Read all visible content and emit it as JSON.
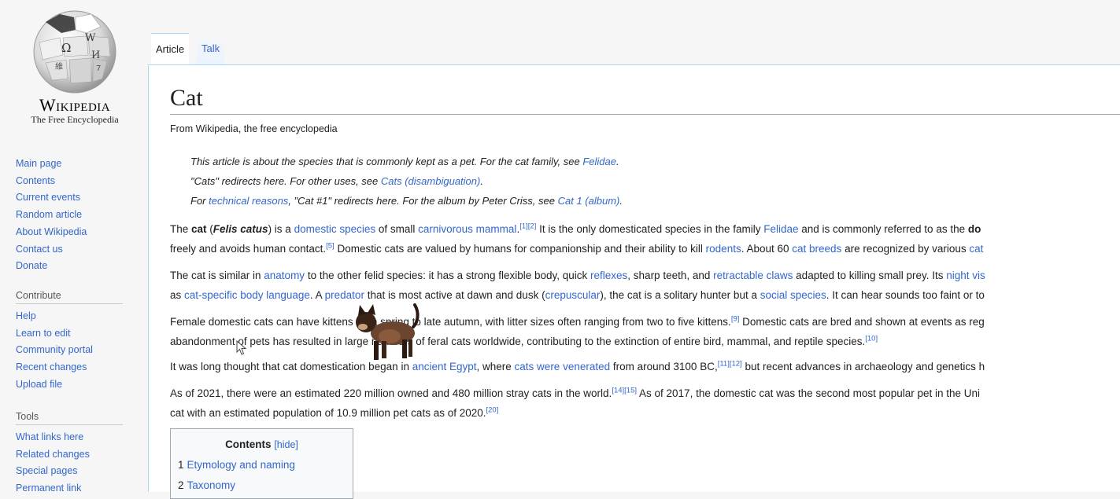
{
  "sidebar": {
    "wordmark": "Wikipedia",
    "tagline": "The Free Encyclopedia",
    "main_links": [
      "Main page",
      "Contents",
      "Current events",
      "Random article",
      "About Wikipedia",
      "Contact us",
      "Donate"
    ],
    "contribute": {
      "heading": "Contribute",
      "links": [
        "Help",
        "Learn to edit",
        "Community portal",
        "Recent changes",
        "Upload file"
      ]
    },
    "tools": {
      "heading": "Tools",
      "links": [
        "What links here",
        "Related changes",
        "Special pages",
        "Permanent link"
      ]
    }
  },
  "tabs": {
    "article": "Article",
    "talk": "Talk"
  },
  "article": {
    "title": "Cat",
    "site_sub": "From Wikipedia, the free encyclopedia",
    "hatnotes": [
      [
        {
          "t": "This article is about the species that is commonly kept as a pet. For the cat family, see "
        },
        {
          "t": "Felidae",
          "l": 1
        },
        {
          "t": "."
        }
      ],
      [
        {
          "t": "\"Cats\" redirects here. For other uses, see "
        },
        {
          "t": "Cats (disambiguation)",
          "l": 1
        },
        {
          "t": "."
        }
      ],
      [
        {
          "t": "For "
        },
        {
          "t": "technical reasons",
          "l": 1
        },
        {
          "t": ", \"Cat #1\" redirects here. For the album by Peter Criss, see "
        },
        {
          "t": "Cat 1 (album)",
          "l": 1
        },
        {
          "t": "."
        }
      ]
    ],
    "paragraphs": [
      [
        [
          {
            "t": "The "
          },
          {
            "t": "cat",
            "b": 1
          },
          {
            "t": " ("
          },
          {
            "t": "Felis catus",
            "b": 1,
            "i": 1
          },
          {
            "t": ") is a "
          },
          {
            "t": "domestic species",
            "l": 1
          },
          {
            "t": " of small "
          },
          {
            "t": "carnivorous mammal",
            "l": 1
          },
          {
            "t": "."
          },
          {
            "t": "[1][2]",
            "s": 1
          },
          {
            "t": " It is the only domesticated species in the family "
          },
          {
            "t": "Felidae",
            "l": 1
          },
          {
            "t": " and is commonly referred to as the "
          },
          {
            "t": "do",
            "b": 1
          }
        ],
        [
          {
            "t": "freely and avoids human contact."
          },
          {
            "t": "[5]",
            "s": 1
          },
          {
            "t": " Domestic cats are valued by humans for companionship and their ability to kill "
          },
          {
            "t": "rodents",
            "l": 1
          },
          {
            "t": ". About 60 "
          },
          {
            "t": "cat breeds",
            "l": 1
          },
          {
            "t": " are recognized by various "
          },
          {
            "t": "cat",
            "l": 1
          }
        ]
      ],
      [
        [
          {
            "t": "The cat is similar in "
          },
          {
            "t": "anatomy",
            "l": 1
          },
          {
            "t": " to the other felid species: it has a strong flexible body, quick "
          },
          {
            "t": "reflexes",
            "l": 1
          },
          {
            "t": ", sharp teeth, and "
          },
          {
            "t": "retractable claws",
            "l": 1
          },
          {
            "t": " adapted to killing small prey. Its "
          },
          {
            "t": "night vis",
            "l": 1
          }
        ],
        [
          {
            "t": "as "
          },
          {
            "t": "cat-specific body language",
            "l": 1
          },
          {
            "t": ". A "
          },
          {
            "t": "predator",
            "l": 1
          },
          {
            "t": " that is most active at dawn and dusk ("
          },
          {
            "t": "crepuscular",
            "l": 1
          },
          {
            "t": "), the cat is a solitary hunter but a "
          },
          {
            "t": "social species",
            "l": 1
          },
          {
            "t": ". It can hear sounds too faint or to"
          }
        ]
      ],
      [
        [
          {
            "t": "Female domestic cats can have kittens from spring to late autumn, with litter sizes often ranging from two to five kittens."
          },
          {
            "t": "[9]",
            "s": 1
          },
          {
            "t": " Domestic cats are bred and shown at events as reg"
          }
        ],
        [
          {
            "t": "abandonment of pets has resulted in large numbers of feral cats worldwide, contributing to the extinction of entire bird, mammal, and reptile species."
          },
          {
            "t": "[10]",
            "s": 1
          }
        ]
      ],
      [
        [
          {
            "t": "It was long thought that cat domestication began in "
          },
          {
            "t": "ancient Egypt",
            "l": 1
          },
          {
            "t": ", where "
          },
          {
            "t": "cats were venerated",
            "l": 1
          },
          {
            "t": " from around 3100 BC,"
          },
          {
            "t": "[11][12]",
            "s": 1
          },
          {
            "t": " but recent advances in archaeology and genetics h"
          }
        ]
      ],
      [
        [
          {
            "t": "As of 2021, there were an estimated 220 million owned and 480 million stray cats in the world."
          },
          {
            "t": "[14][15]",
            "s": 1
          },
          {
            "t": " As of 2017, the domestic cat was the second most popular pet in the Uni"
          }
        ],
        [
          {
            "t": "cat with an estimated population of 10.9 million pet cats as of 2020."
          },
          {
            "t": "[20]",
            "s": 1
          }
        ]
      ]
    ],
    "toc": {
      "title": "Contents",
      "hide": "[hide]",
      "items": [
        {
          "num": "1",
          "label": "Etymology and naming"
        },
        {
          "num": "2",
          "label": "Taxonomy"
        }
      ]
    }
  },
  "colors": {
    "link": "#3366cc",
    "background": "#f6f6f6",
    "content": "#ffffff",
    "border": "#a7d7f9"
  }
}
